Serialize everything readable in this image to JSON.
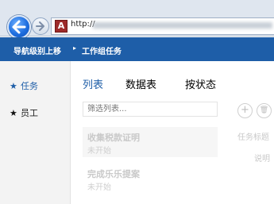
{
  "browser": {
    "url": "http://",
    "site_icon_letter": "A"
  },
  "ribbon": {
    "navigate_up_label": "导航级别上移",
    "breadcrumb_separator": "▸",
    "breadcrumb": "工作组任务"
  },
  "left_nav": {
    "items": [
      {
        "label": "任务",
        "active": true
      },
      {
        "label": "员工",
        "active": false
      }
    ],
    "star": "★"
  },
  "tabs": [
    {
      "label": "列表"
    },
    {
      "label": "数据表"
    },
    {
      "label": "按状态"
    }
  ],
  "filter": {
    "placeholder": "筛选列表..."
  },
  "buttons": {
    "add": "+",
    "delete": "🗑"
  },
  "list": [
    {
      "title": "收集税款证明",
      "status": "未开始"
    },
    {
      "title": "完成乐乐提案",
      "status": "未开始"
    }
  ],
  "detail": {
    "task_title_label": "任务标题",
    "description_label": "说明"
  },
  "colors": {
    "ribbon": "#1e5ea8",
    "accent": "#1e5ea8"
  }
}
